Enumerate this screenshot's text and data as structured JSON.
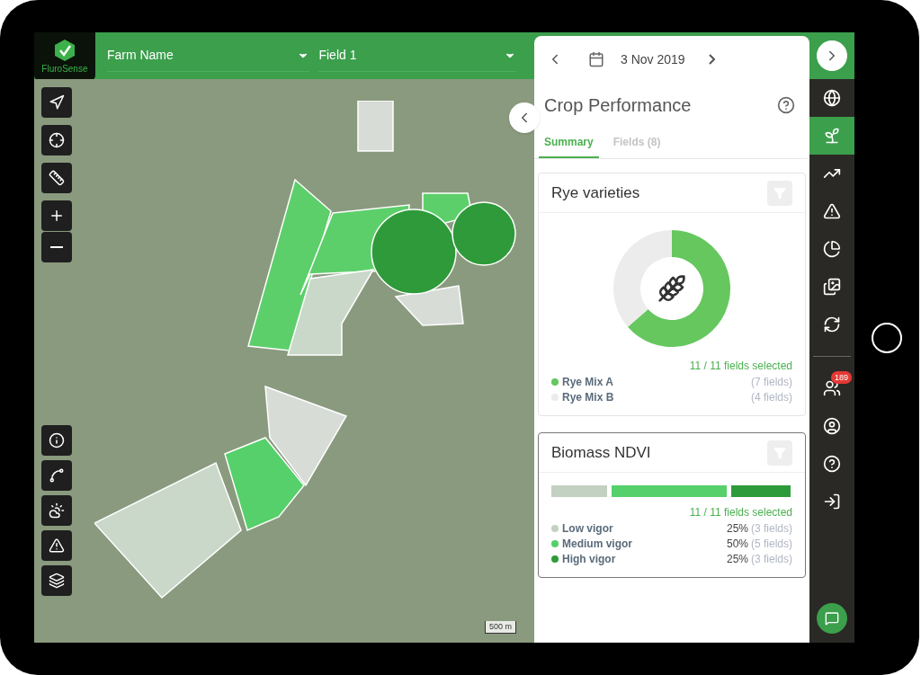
{
  "header": {
    "logo_text": "FluroSense",
    "farm_select": "Farm Name",
    "field_select": "Field 1"
  },
  "map": {
    "scale": "500 m"
  },
  "panel": {
    "date": "3 Nov 2019",
    "title": "Crop Performance",
    "tabs": [
      {
        "label": "Summary",
        "selected": true
      },
      {
        "label": "Fields (8)",
        "selected": false
      }
    ],
    "varieties_card": {
      "title": "Rye varieties",
      "chart_data": {
        "type": "donut",
        "categories": [
          "Rye Mix A",
          "Rye Mix B"
        ],
        "series": [
          {
            "values": [
              63.6,
              36.4
            ]
          }
        ]
      },
      "selection": "11 / 11 fields selected",
      "legend": [
        {
          "count": "(7 fields)",
          "color": "#66c75f"
        },
        {
          "count": "(4 fields)",
          "color": "#ececec"
        }
      ]
    },
    "biomass_card": {
      "title": "Biomass NDVI",
      "selection": "11 / 11 fields selected",
      "legend": [
        {
          "label": "Low vigor",
          "color": "#c3d1c3",
          "percent": "25%",
          "count": "(3 fields)"
        },
        {
          "label": "Medium vigor",
          "color": "#55d06a",
          "percent": "50%",
          "count": "(5 fields)"
        },
        {
          "label": "High vigor",
          "color": "#2e9b3a",
          "percent": "25%",
          "count": "(3 fields)"
        }
      ]
    }
  },
  "rail": {
    "items": [
      {
        "kind": "fields",
        "selected": false
      },
      {
        "kind": "crop",
        "selected": true
      },
      {
        "kind": "trend",
        "selected": false
      },
      {
        "kind": "alert",
        "selected": false
      },
      {
        "kind": "zones",
        "selected": false
      },
      {
        "kind": "images",
        "selected": false
      },
      {
        "kind": "cycle",
        "selected": false
      }
    ],
    "bottom_items": [
      {
        "kind": "team",
        "badge": "189"
      },
      {
        "kind": "user"
      },
      {
        "kind": "help"
      },
      {
        "kind": "login"
      }
    ]
  }
}
